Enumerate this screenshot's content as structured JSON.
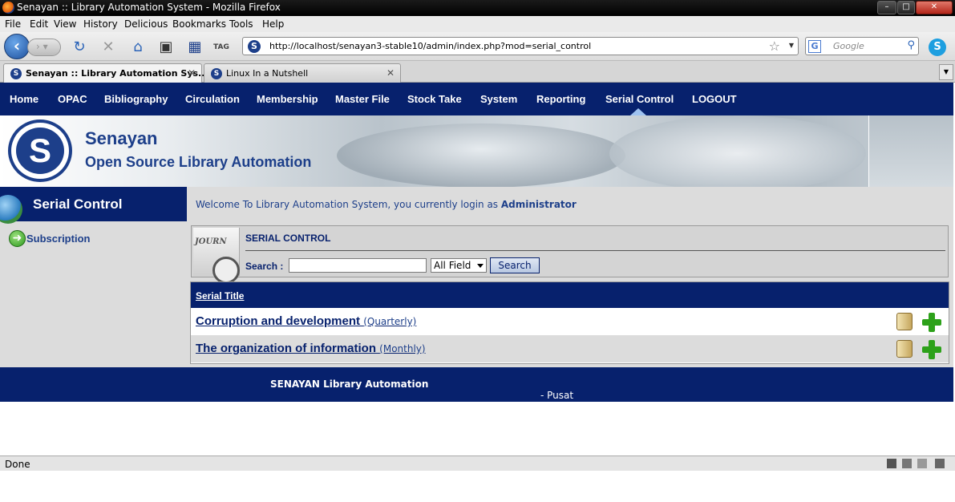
{
  "window": {
    "title": "Senayan :: Library Automation System - Mozilla Firefox"
  },
  "menu": [
    "File",
    "Edit",
    "View",
    "History",
    "Delicious",
    "Bookmarks",
    "Tools",
    "Help"
  ],
  "toolbar": {
    "url": "http://localhost/senayan3-stable10/admin/index.php?mod=serial_control",
    "search_placeholder": "Google"
  },
  "tabs": [
    {
      "label": "Senayan :: Library Automation Sys...",
      "active": true
    },
    {
      "label": "Linux In a Nutshell",
      "active": false
    }
  ],
  "app_nav": [
    "Home",
    "OPAC",
    "Bibliography",
    "Circulation",
    "Membership",
    "Master File",
    "Stock Take",
    "System",
    "Reporting",
    "Serial Control",
    "LOGOUT"
  ],
  "banner": {
    "title": "Senayan",
    "subtitle": "Open Source Library Automation"
  },
  "sidebar": {
    "heading": "Serial Control",
    "items": [
      "Subscription"
    ]
  },
  "welcome": {
    "text": "Welcome To Library Automation System, you currently login as",
    "user": "Administrator"
  },
  "panel": {
    "title": "SERIAL CONTROL",
    "journal_label": "JOURN",
    "search_label": "Search :",
    "search_value": "",
    "field_select": "All Field",
    "search_button": "Search"
  },
  "table": {
    "header": "Serial Title",
    "rows": [
      {
        "title": "Corruption and development",
        "frequency": "(Quarterly)"
      },
      {
        "title": "The organization of information",
        "frequency": "(Monthly)"
      }
    ]
  },
  "footer": {
    "brand": "SENAYAN Library Automation",
    "text": "- Pusat Informasi dan Humas Depdiknas RI - Released Under GNU GPL License"
  },
  "status": {
    "text": "Done"
  },
  "colors": {
    "nav_bg": "#07216d",
    "panel_bg": "#dcdcdc",
    "add_green": "#2da11a"
  }
}
